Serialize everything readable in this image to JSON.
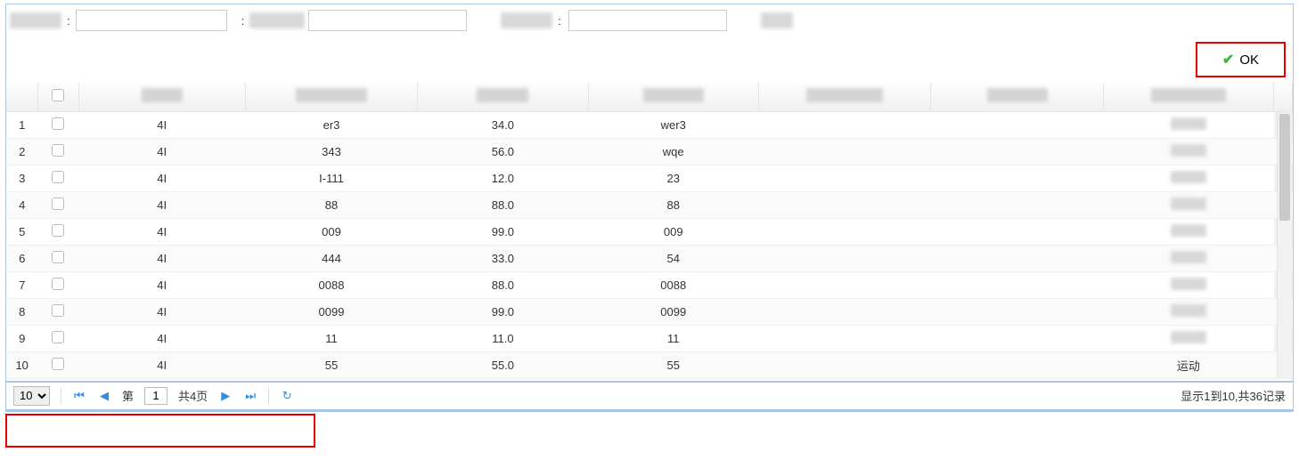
{
  "filter": {
    "colon": ":",
    "input1": "",
    "input2": "",
    "input3": ""
  },
  "ok": {
    "label": "OK"
  },
  "table": {
    "rows": [
      {
        "n": "1",
        "a": "4I",
        "b": "er3",
        "c": "34.0",
        "d": "wer3"
      },
      {
        "n": "2",
        "a": "4I",
        "b": "343",
        "c": "56.0",
        "d": "wqe"
      },
      {
        "n": "3",
        "a": "4I",
        "b": "I-111",
        "c": "12.0",
        "d": "23"
      },
      {
        "n": "4",
        "a": "4I",
        "b": "88",
        "c": "88.0",
        "d": "88"
      },
      {
        "n": "5",
        "a": "4I",
        "b": "009",
        "c": "99.0",
        "d": "009"
      },
      {
        "n": "6",
        "a": "4I",
        "b": "444",
        "c": "33.0",
        "d": "54"
      },
      {
        "n": "7",
        "a": "4I",
        "b": "0088",
        "c": "88.0",
        "d": "0088"
      },
      {
        "n": "8",
        "a": "4I",
        "b": "0099",
        "c": "99.0",
        "d": "0099"
      },
      {
        "n": "9",
        "a": "4I",
        "b": "11",
        "c": "11.0",
        "d": "11"
      },
      {
        "n": "10",
        "a": "4I",
        "b": "55",
        "c": "55.0",
        "d": "55"
      }
    ],
    "last_row_g": "运动"
  },
  "pager": {
    "page_size": "10",
    "page_prefix": "第",
    "current_page": "1",
    "total_pages_label": "共4页",
    "summary": "显示1到10,共36记录"
  }
}
